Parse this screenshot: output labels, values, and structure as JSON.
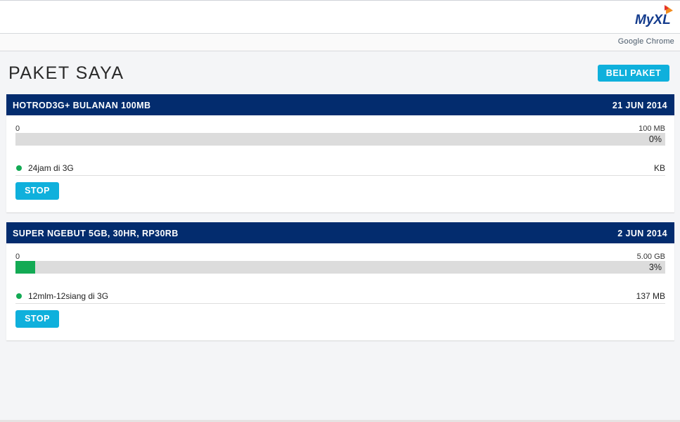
{
  "header": {
    "logo_text": "MyXL",
    "browser_label": "Google Chrome"
  },
  "page": {
    "title": "PAKET SAYA",
    "buy_button": "BELI PAKET"
  },
  "packages": [
    {
      "name": "HOTROD3G+ BULANAN 100MB",
      "date": "21 JUN 2014",
      "min_label": "0",
      "max_label": "100 MB",
      "percent_label": "0%",
      "usage_fraction": 0.0,
      "quota_label": "24jam di 3G",
      "quota_value": "KB",
      "stop_label": "STOP"
    },
    {
      "name": "SUPER NGEBUT 5GB, 30HR, RP30RB",
      "date": "2 JUN 2014",
      "min_label": "0",
      "max_label": "5.00 GB",
      "percent_label": "3%",
      "usage_fraction": 0.03,
      "quota_label": "12mlm-12siang di 3G",
      "quota_value": "137 MB",
      "stop_label": "STOP"
    }
  ],
  "colors": {
    "header_bar": "#032c6e",
    "accent_button": "#0fb0dc",
    "progress_fill": "#13aa54",
    "progress_track": "#dcdcdc"
  }
}
